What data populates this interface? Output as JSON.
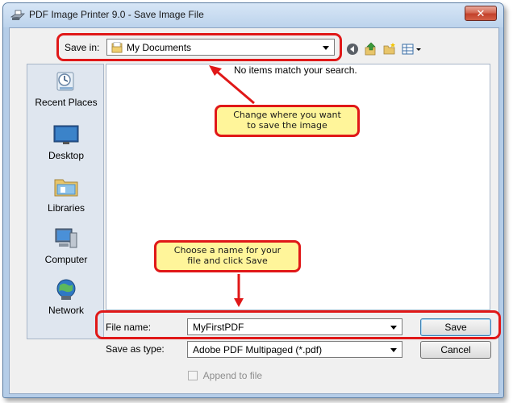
{
  "window": {
    "title": "PDF Image Printer 9.0 - Save Image File",
    "close_glyph": "✕"
  },
  "toolbar": {
    "save_in_label": "Save in:",
    "save_in_value": "My Documents",
    "icons": [
      "back-icon",
      "up-folder-icon",
      "new-folder-icon",
      "view-menu-icon"
    ]
  },
  "places": [
    {
      "label": "Recent Places",
      "icon": "recent-places-icon"
    },
    {
      "label": "Desktop",
      "icon": "desktop-icon"
    },
    {
      "label": "Libraries",
      "icon": "libraries-icon"
    },
    {
      "label": "Computer",
      "icon": "computer-icon"
    },
    {
      "label": "Network",
      "icon": "network-icon"
    }
  ],
  "file_list": {
    "empty_message": "No items match your search."
  },
  "form": {
    "file_name_label": "File name:",
    "file_name_value": "MyFirstPDF",
    "save_as_type_label": "Save as type:",
    "save_as_type_value": "Adobe PDF Multipaged (*.pdf)",
    "append_label": "Append to file",
    "append_checked": false
  },
  "buttons": {
    "save": "Save",
    "cancel": "Cancel"
  },
  "annotations": {
    "callout_top": [
      "Change where you want",
      "to save the image"
    ],
    "callout_bottom": [
      "Choose a name for your",
      "file and click Save"
    ],
    "color": "#e01818",
    "callout_fill": "#fff59a"
  }
}
